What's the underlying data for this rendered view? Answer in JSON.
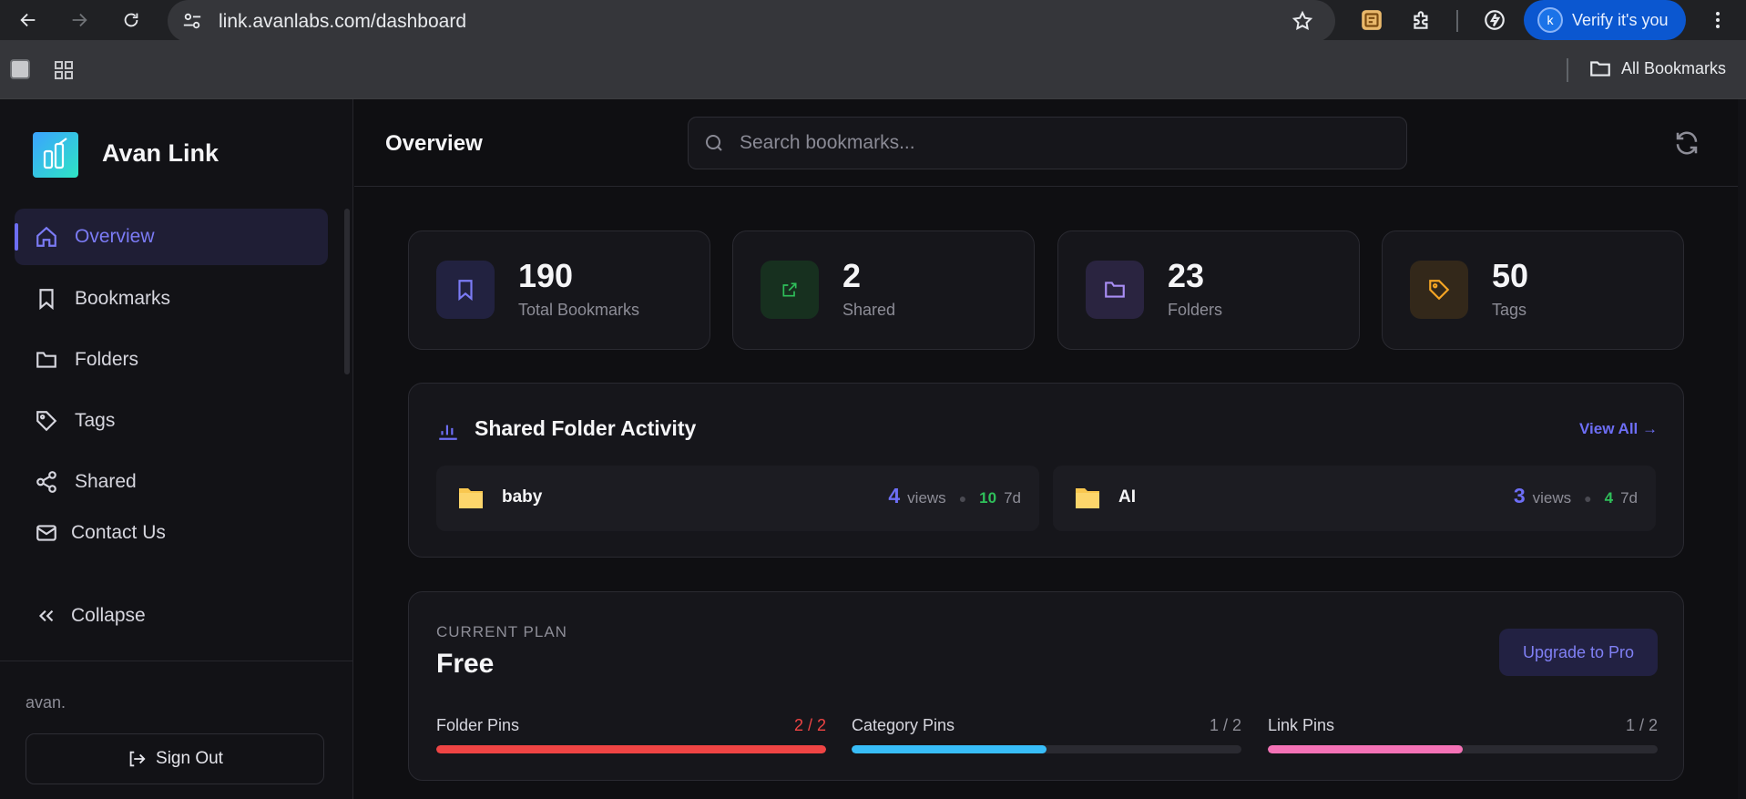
{
  "browser": {
    "url": "link.avanlabs.com/dashboard",
    "verify_label": "Verify it's you",
    "avatar_letter": "k",
    "all_bookmarks_label": "All Bookmarks"
  },
  "sidebar": {
    "brand": "Avan Link",
    "items": [
      {
        "label": "Overview",
        "icon": "home-icon",
        "active": true
      },
      {
        "label": "Bookmarks",
        "icon": "bookmark-icon"
      },
      {
        "label": "Folders",
        "icon": "folder-icon"
      },
      {
        "label": "Tags",
        "icon": "tag-icon"
      },
      {
        "label": "Shared",
        "icon": "share-icon"
      },
      {
        "label": "Contact Us",
        "icon": "mail-icon"
      }
    ],
    "collapse_label": "Collapse",
    "user_name": "avan.",
    "sign_out_label": "Sign Out"
  },
  "header": {
    "title": "Overview",
    "search_placeholder": "Search bookmarks..."
  },
  "stats": [
    {
      "value": "190",
      "label": "Total Bookmarks",
      "icon": "bookmark-icon",
      "color": "#7b7bf5"
    },
    {
      "value": "2",
      "label": "Shared",
      "icon": "external-link-icon",
      "color": "#2fbf5a"
    },
    {
      "value": "23",
      "label": "Folders",
      "icon": "folder-icon",
      "color": "#a98ef5"
    },
    {
      "value": "50",
      "label": "Tags",
      "icon": "tag-icon",
      "color": "#f5a524"
    }
  ],
  "activity": {
    "title": "Shared Folder Activity",
    "view_all_label": "View All →",
    "folders": [
      {
        "name": "baby",
        "views": "4",
        "views_label": "views",
        "recent": "10",
        "recent_label": "7d"
      },
      {
        "name": "AI",
        "views": "3",
        "views_label": "views",
        "recent": "4",
        "recent_label": "7d"
      }
    ]
  },
  "plan": {
    "caption": "CURRENT PLAN",
    "name": "Free",
    "upgrade_label": "Upgrade to Pro",
    "pins": [
      {
        "label": "Folder Pins",
        "value": "2 / 2",
        "fraction": 1.0,
        "color": "#ef4444",
        "value_color": "#ef4444"
      },
      {
        "label": "Category Pins",
        "value": "1 / 2",
        "fraction": 0.5,
        "color": "#38bdf8",
        "value_color": "#8d8d97"
      },
      {
        "label": "Link Pins",
        "value": "1 / 2",
        "fraction": 0.5,
        "color": "#f472b6",
        "value_color": "#8d8d97"
      }
    ]
  },
  "colors": {
    "accent": "#6d6ef5",
    "success": "#2fbf5a"
  }
}
